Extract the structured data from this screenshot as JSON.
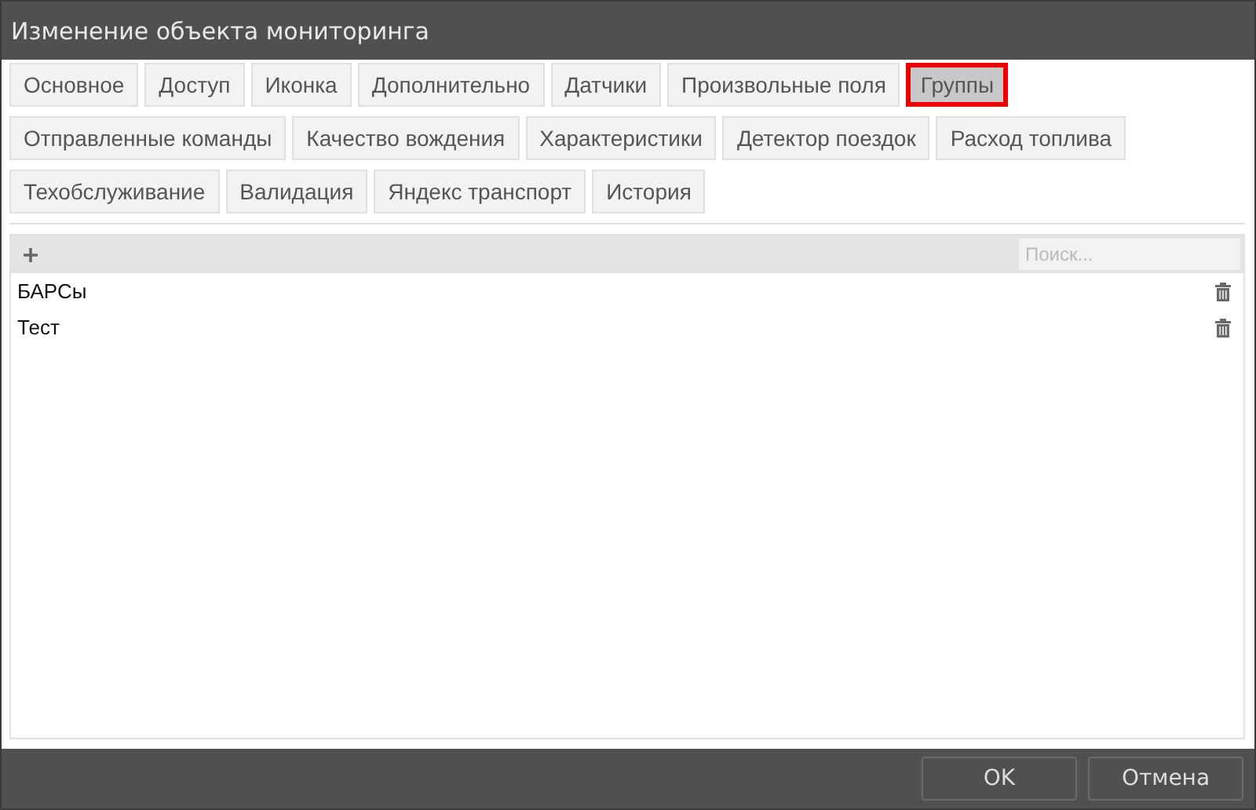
{
  "window": {
    "title": "Изменение объекта мониторинга"
  },
  "tab_rows": [
    [
      {
        "label": "Основное",
        "selected": false
      },
      {
        "label": "Доступ",
        "selected": false
      },
      {
        "label": "Иконка",
        "selected": false
      },
      {
        "label": "Дополнительно",
        "selected": false
      },
      {
        "label": "Датчики",
        "selected": false
      },
      {
        "label": "Произвольные поля",
        "selected": false
      },
      {
        "label": "Группы",
        "selected": true
      }
    ],
    [
      {
        "label": "Отправленные команды",
        "selected": false
      },
      {
        "label": "Качество вождения",
        "selected": false
      },
      {
        "label": "Характеристики",
        "selected": false
      },
      {
        "label": "Детектор поездок",
        "selected": false
      },
      {
        "label": "Расход топлива",
        "selected": false
      }
    ],
    [
      {
        "label": "Техобслуживание",
        "selected": false
      },
      {
        "label": "Валидация",
        "selected": false
      },
      {
        "label": "Яндекс транспорт",
        "selected": false
      },
      {
        "label": "История",
        "selected": false
      }
    ]
  ],
  "toolbar": {
    "search": {
      "placeholder": "Поиск..."
    }
  },
  "groups": [
    {
      "name": "БАРСы"
    },
    {
      "name": "Тест"
    }
  ],
  "buttons": [
    "OK",
    "Отмена"
  ]
}
